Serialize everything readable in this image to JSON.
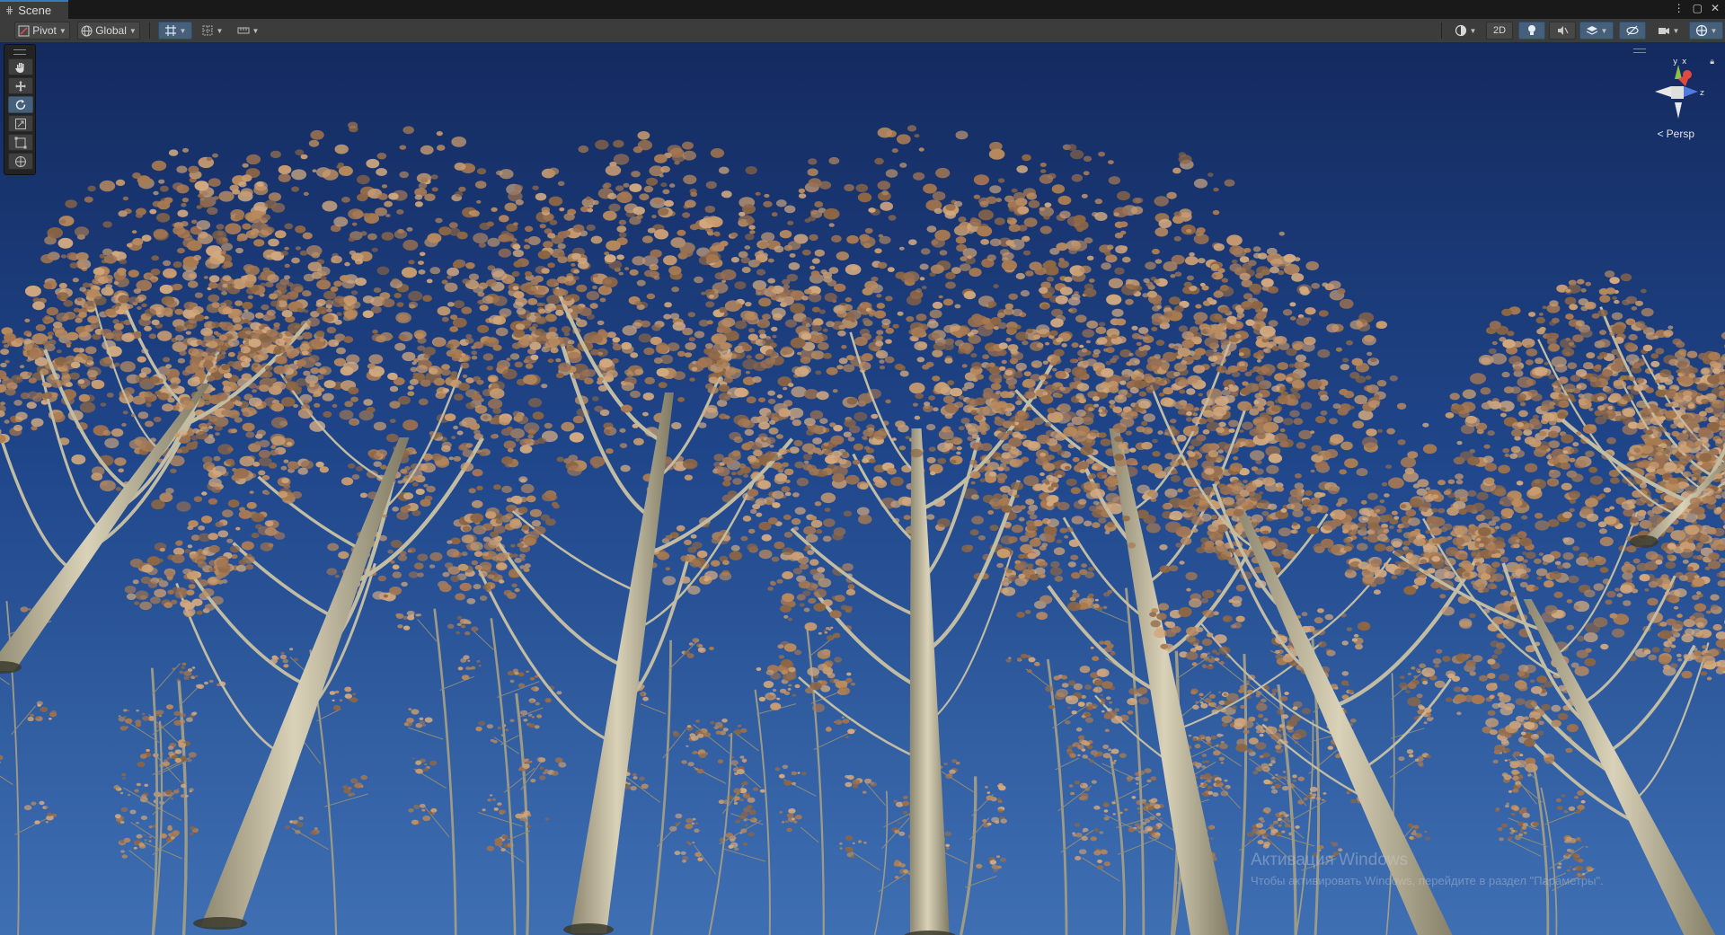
{
  "window": {
    "tab_label": "Scene",
    "tab_icon": "hash-icon",
    "controls": [
      "⋮",
      "▢",
      "✕"
    ]
  },
  "toolbar": {
    "pivot_label": "Pivot",
    "global_label": "Global",
    "two_d_label": "2D"
  },
  "tools": [
    "hand-tool",
    "move-tool",
    "rotate-tool",
    "scale-tool",
    "rect-tool",
    "transform-tool"
  ],
  "active_tool": "rotate-tool",
  "gizmo": {
    "view_label": "Persp",
    "axis_y": "y",
    "axis_x": "x",
    "axis_z": "z"
  },
  "watermark": {
    "title": "Активация Windows",
    "subtitle": "Чтобы активировать Windows, перейдите в раздел \"Параметры\"."
  },
  "colors": {
    "sky_top": "#152a5e",
    "sky_bottom": "#3f6fb5",
    "foliage": "#b98a5f",
    "trunk": "#cfc7ad",
    "accent": "#46607c"
  }
}
